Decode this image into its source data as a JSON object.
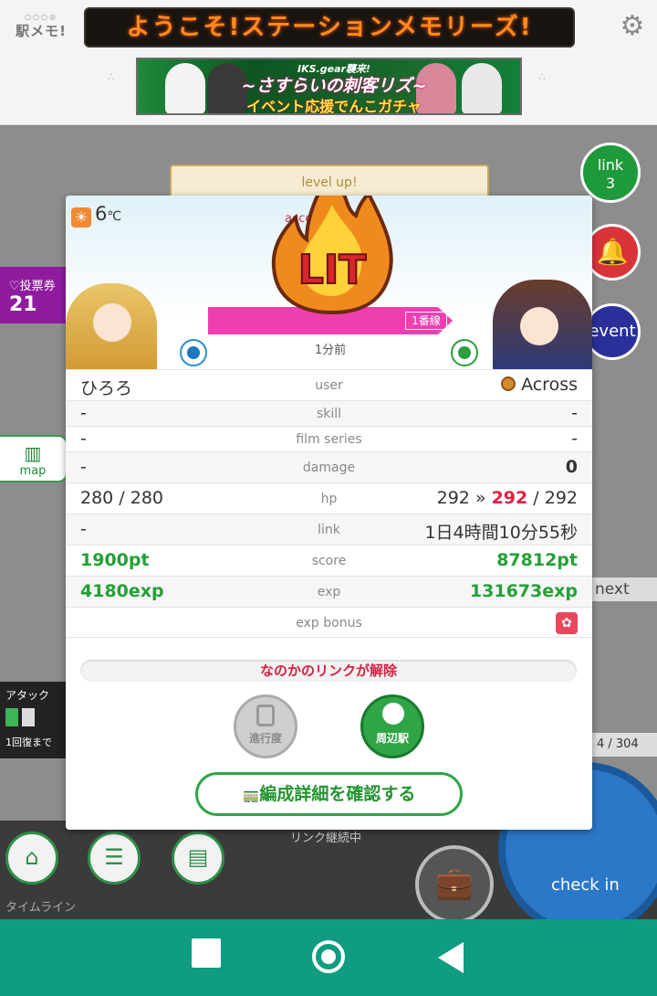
{
  "header": {
    "logo_text": "駅メモ!",
    "marquee": "ようこそ!ステーションメモリーズ!",
    "banner": {
      "top": "IKS.gear襲来!",
      "title": "~さすらいの刺客リズ~",
      "sub": "イベント応援でんこガチャ"
    }
  },
  "background": {
    "card_text": "level up!",
    "link_badge": {
      "label": "link",
      "count": "3"
    },
    "event_label": "event",
    "vote": {
      "label": "♡投票券",
      "count": "21"
    },
    "map_label": "map",
    "next_label": "next",
    "attack_label": "アタック",
    "recovery_label": "1回復まで",
    "link_continue": "リンク継続中",
    "hp_side": "4 / 304",
    "timeline": "タイムライン",
    "checkin_label": "check in"
  },
  "modal": {
    "temperature": "6",
    "temp_unit": "℃",
    "access_text": "access connect",
    "lit_label": "LIT",
    "line_badge": "1番線",
    "time_ago": "1分前",
    "rows": [
      {
        "left": "ひろろ",
        "label": "user",
        "right": "Across"
      },
      {
        "left": "-",
        "label": "skill",
        "right": "-"
      },
      {
        "left": "-",
        "label": "film series",
        "right": "-"
      },
      {
        "left": "-",
        "label": "damage",
        "right": "0"
      },
      {
        "left": "280 / 280",
        "label": "hp",
        "right_a": "292 » ",
        "right_b": "292",
        "right_c": " / 292"
      },
      {
        "left": "-",
        "label": "link",
        "right": "1日4時間10分55秒"
      },
      {
        "left": "1900pt",
        "label": "score",
        "right": "87812pt"
      },
      {
        "left": "4180exp",
        "label": "exp",
        "right": "131673exp"
      },
      {
        "left": "",
        "label": "exp bonus",
        "right": ""
      }
    ],
    "release_text": "なのかのリンクが解除",
    "progress_label": "進行度",
    "nearby_label": "周辺駅",
    "confirm_label": "編成詳細を確認する"
  },
  "colors": {
    "accent_green": "#2fa546",
    "alert_red": "#e2203e",
    "android_bar": "#109c80"
  }
}
